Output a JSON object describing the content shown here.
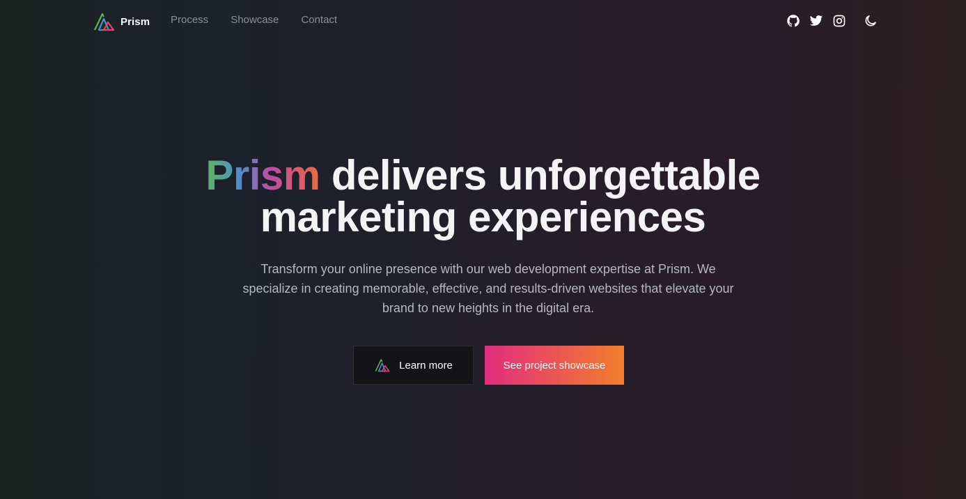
{
  "nav": {
    "brand": "Prism",
    "links": [
      "Process",
      "Showcase",
      "Contact"
    ],
    "icons": [
      "github-icon",
      "twitter-icon",
      "instagram-icon",
      "moon-icon"
    ]
  },
  "hero": {
    "title_brand": "Prism",
    "title_rest": "delivers unforgettable",
    "title_line2": "marketing experiences",
    "subtitle": "Transform your online presence with our web development expertise at Prism. We specialize in creating memorable, effective, and results-driven websites that elevate your brand to new heights in the digital era.",
    "buttons": {
      "learn_more": "Learn more",
      "showcase": "See project showcase"
    }
  },
  "colors": {
    "accent_start": "#e12d7e",
    "accent_end": "#f37d2b",
    "nav_link": "#8b8f98",
    "subtitle": "#b4b8c2"
  }
}
